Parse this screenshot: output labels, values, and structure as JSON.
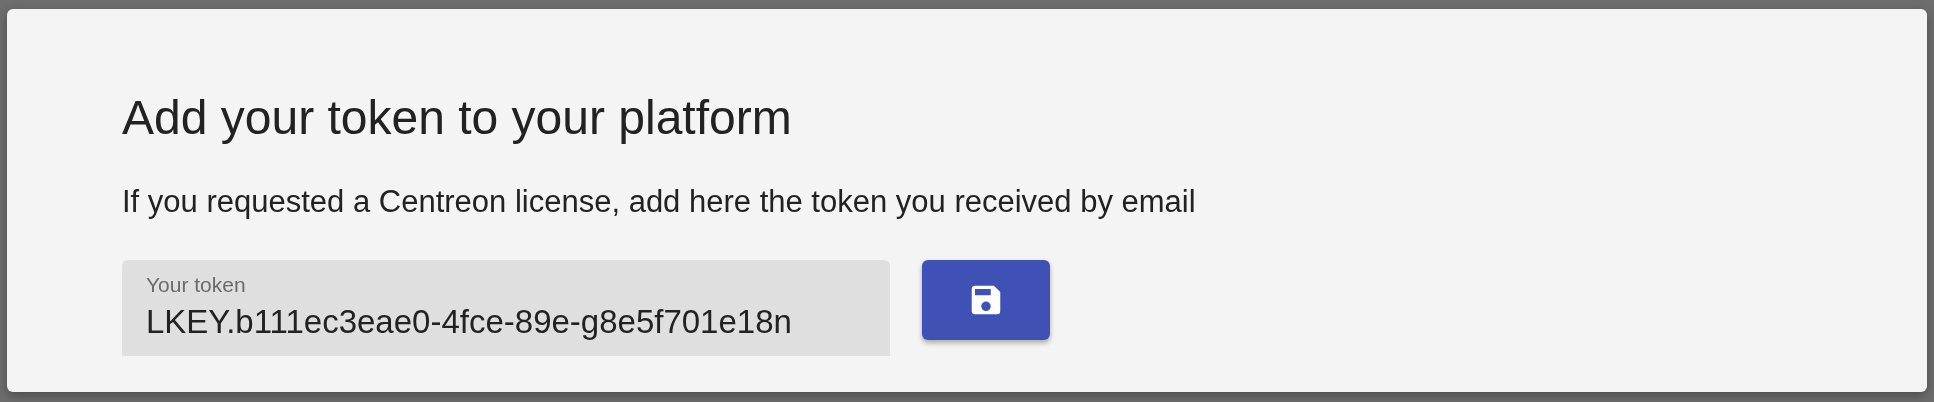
{
  "dialog": {
    "title": "Add your token to your platform",
    "description": "If you requested a Centreon license, add here the token you received by email",
    "token_field": {
      "label": "Your token",
      "value": "LKEY.b111ec3eae0-4fce-89e-g8e5f701e18n"
    }
  }
}
